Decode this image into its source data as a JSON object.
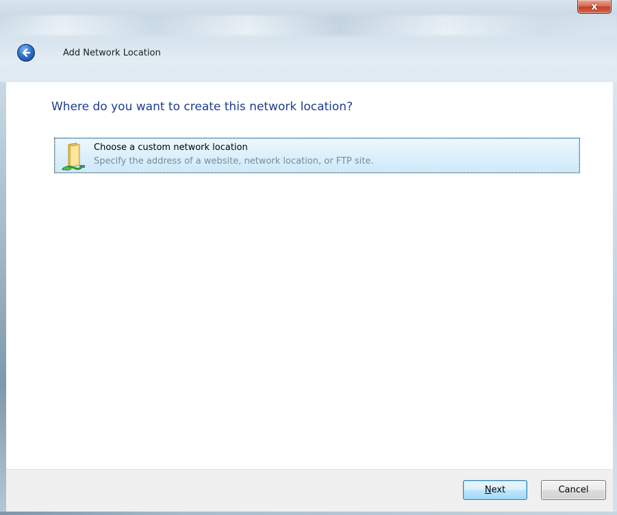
{
  "window": {
    "title": "Add Network Location",
    "close_glyph": "x"
  },
  "content": {
    "heading": "Where do you want to create this network location?",
    "options": [
      {
        "title": "Choose a custom network location",
        "description": "Specify the address of a website, network location, or FTP site.",
        "icon": "network-folder-icon"
      }
    ]
  },
  "footer": {
    "next_mnemonic": "N",
    "next_rest": "ext",
    "cancel_label": "Cancel"
  },
  "colors": {
    "heading": "#1e3b8f",
    "description": "#7a8a98",
    "selection": "#cfe9f8",
    "close_button": "#c4402a"
  }
}
